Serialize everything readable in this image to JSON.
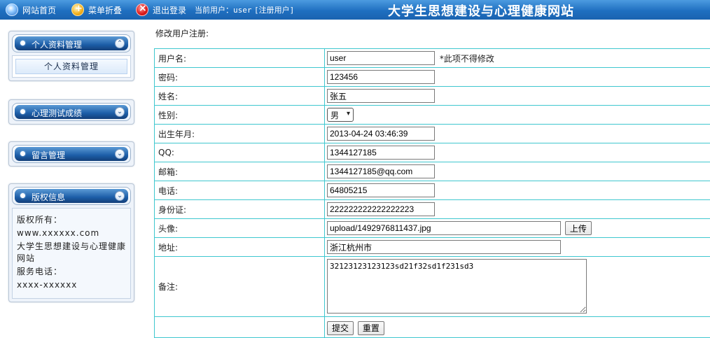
{
  "topbar": {
    "home_label": "网站首页",
    "fold_label": "菜单折叠",
    "logout_label": "退出登录",
    "current_user_prefix": "当前用户：",
    "current_user": "user",
    "current_role": "[注册用户]",
    "site_title": "大学生思想建设与心理健康网站",
    "icons": [
      "home-globe-icon",
      "menu-fold-icon",
      "logout-icon"
    ]
  },
  "sidebar": {
    "panels": [
      {
        "title": "个人资料管理",
        "toggle": "⌃",
        "items": [
          "个人资料管理"
        ]
      },
      {
        "title": "心理测试成绩",
        "toggle": "⌄"
      },
      {
        "title": "留言管理",
        "toggle": "⌄"
      },
      {
        "title": "版权信息",
        "toggle": "⌄",
        "lines": [
          "版权所有：",
          "www.xxxxxx.com",
          "大学生思想建设与心理健康网站",
          "服务电话：",
          "xxxx-xxxxxx"
        ]
      }
    ]
  },
  "main": {
    "heading": "修改用户注册:",
    "fields": {
      "username": {
        "label": "用户名:",
        "value": "user",
        "note": "*此项不得修改"
      },
      "password": {
        "label": "密码:",
        "value": "123456"
      },
      "name": {
        "label": "姓名:",
        "value": "张五"
      },
      "gender": {
        "label": "性别:",
        "value": "男"
      },
      "birthday": {
        "label": "出生年月:",
        "value": "2013-04-24 03:46:39"
      },
      "qq": {
        "label": "QQ:",
        "value": "1344127185"
      },
      "email": {
        "label": "邮箱:",
        "value": "1344127185@qq.com"
      },
      "phone": {
        "label": "电话:",
        "value": "64805215"
      },
      "id_card": {
        "label": "身份证:",
        "value": "222222222222222223"
      },
      "avatar": {
        "label": "头像:",
        "value": "upload/1492976811437.jpg",
        "button": "上传"
      },
      "address": {
        "label": "地址:",
        "value": "浙江杭州市"
      },
      "remark": {
        "label": "备注:",
        "value": "32123123123123sd21f32sd1f231sd3"
      }
    },
    "submit_label": "提交",
    "reset_label": "重置"
  }
}
